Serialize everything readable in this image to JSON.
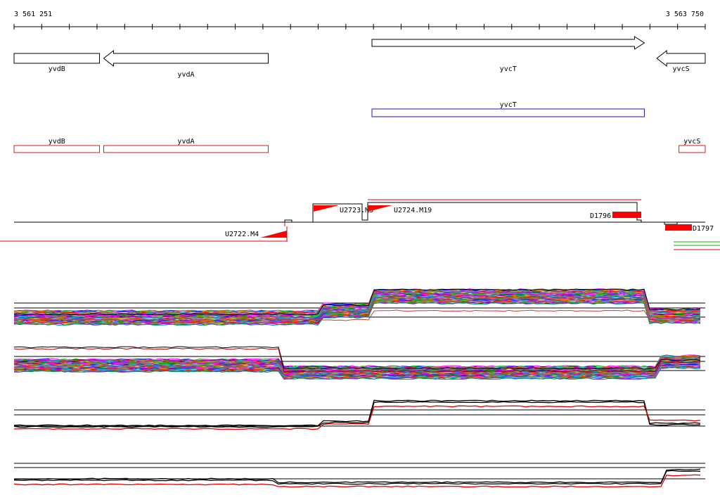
{
  "axis": {
    "start_label": "3 561 251",
    "end_label": "3 563 750",
    "start": 3561251,
    "end": 3563750
  },
  "colors": {
    "gene_outline": "#000000",
    "blue_feature": "#1a1ab8",
    "red_feature": "#d61a1a",
    "region_fill": "#ff0000",
    "profile_primary": "#000000",
    "profile_secondary": "#e00000"
  },
  "tracks": {
    "genes": [
      {
        "name": "yvdB",
        "strand": "+",
        "start": 3561251,
        "end": 3561560
      },
      {
        "name": "yvdA",
        "strand": "-",
        "start": 3561575,
        "end": 3562170
      },
      {
        "name": "yvcT",
        "strand": "+",
        "start": 3562545,
        "end": 3563530
      },
      {
        "name": "yvcS",
        "strand": "-",
        "start": 3563575,
        "end": 3563750
      }
    ],
    "blue_features": [
      {
        "name": "yvcT",
        "start": 3562545,
        "end": 3563530
      }
    ],
    "red_features": [
      {
        "name": "yvdB",
        "start": 3561251,
        "end": 3561560
      },
      {
        "name": "yvdA",
        "start": 3561575,
        "end": 3562170
      },
      {
        "name": "yvcS",
        "start": 3563655,
        "end": 3563750
      }
    ],
    "regions": [
      {
        "name": "U2722.M4",
        "start": 3561221,
        "end": 3562220,
        "strand": "-"
      },
      {
        "name": "U2723.M3",
        "start": 3562305,
        "end": 3562520,
        "strand": "+"
      },
      {
        "name": "U2724.M19",
        "start": 3562520,
        "end": 3563490,
        "strand": "+"
      },
      {
        "name": "D1796",
        "start": 3563320,
        "end": 3563490,
        "strand": "+"
      },
      {
        "name": "D1797",
        "start": 3563590,
        "end": 3563750,
        "strand": "-"
      }
    ]
  }
}
